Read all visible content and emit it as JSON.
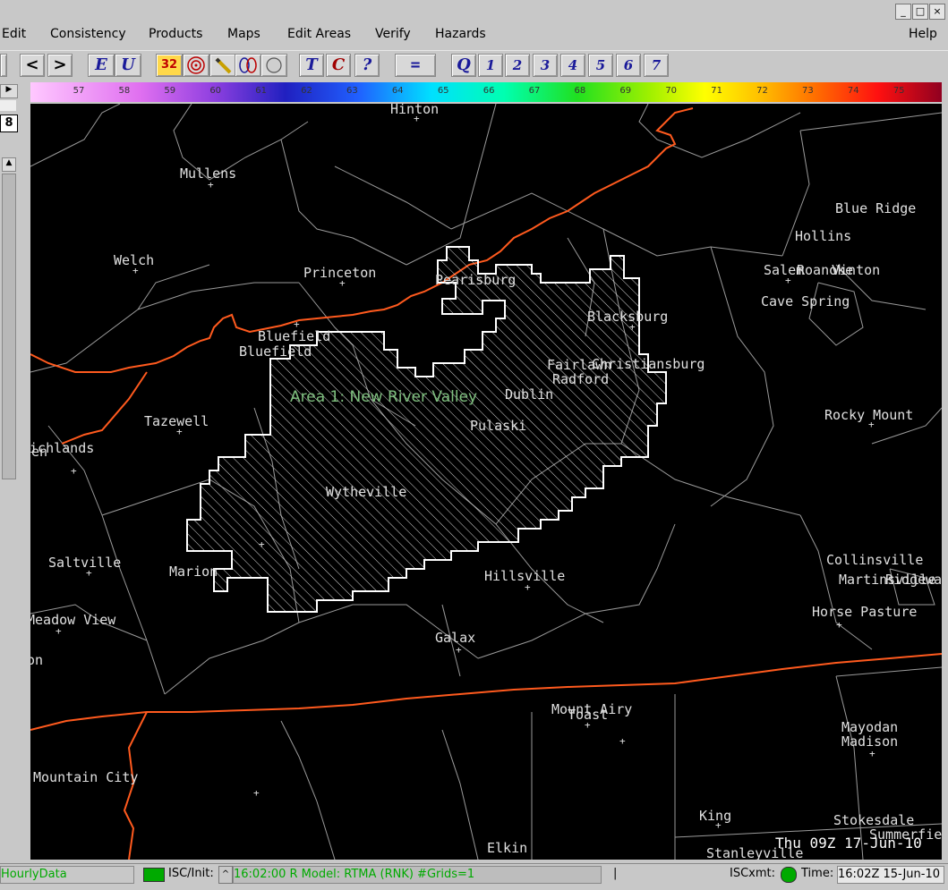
{
  "menu": {
    "items": [
      "Edit",
      "Consistency",
      "Products",
      "Maps",
      "Edit Areas",
      "Verify",
      "Hazards",
      "Help"
    ]
  },
  "toolbar": {
    "buttons": [
      "<",
      ">",
      "E",
      "U",
      "32",
      "T",
      "C",
      "?",
      "=",
      "Q",
      "1",
      "2",
      "3",
      "4",
      "5",
      "6",
      "7"
    ]
  },
  "colorbar": {
    "ticks": [
      "57",
      "58",
      "59",
      "60",
      "61",
      "62",
      "63",
      "64",
      "65",
      "66",
      "67",
      "68",
      "69",
      "70",
      "71",
      "72",
      "73",
      "74",
      "75"
    ]
  },
  "left_strip": {
    "number": "8"
  },
  "map": {
    "area_label": "Area 1: New River Valley",
    "date_stamp": "Thu 09Z  17-Jun-10",
    "cities": [
      "Hinton",
      "Mullens",
      "Blue Ridge",
      "Hollins",
      "Welch",
      "Princeton",
      "Pearisburg",
      "Salem",
      "Roanoke",
      "Vinton",
      "Cave Spring",
      "Blacksburg",
      "Bluefield",
      "Bluefield",
      "Fairlawn",
      "Christiansburg",
      "Radford",
      "Dublin",
      "Tazewell",
      "Rocky Mount",
      "Richlands",
      "Pulaski",
      "Wytheville",
      "Saltville",
      "Collinsville",
      "Martinsville",
      "Marion",
      "Hillsville",
      "Horse Pasture",
      "Meadow View",
      "Galax",
      "Mount Airy",
      "Toast",
      "Mayodan",
      "Madison",
      "Mountain City",
      "King",
      "Stokesdale",
      "Summerfield",
      "Elkin",
      "Stanleyville"
    ],
    "cut_labels": [
      "ven",
      "on",
      "Ridgeway"
    ]
  },
  "status": {
    "mode": "HourlyData",
    "isc_init": "ISC/Init:",
    "model_text": "16:02:00 R Model: RTMA (RNK) #Grids=1",
    "cursor": "|",
    "isc_xmt": "ISCxmt:",
    "time_label": "Time:",
    "time_value": "16:02Z 15-Jun-10"
  },
  "colors": {
    "background": "#000000",
    "state_border": "#ff5a1e",
    "county_lines": "#9a9a9a",
    "area_outline": "#ffffff",
    "area_label": "#7fc07f",
    "status_green": "#00aa00"
  }
}
